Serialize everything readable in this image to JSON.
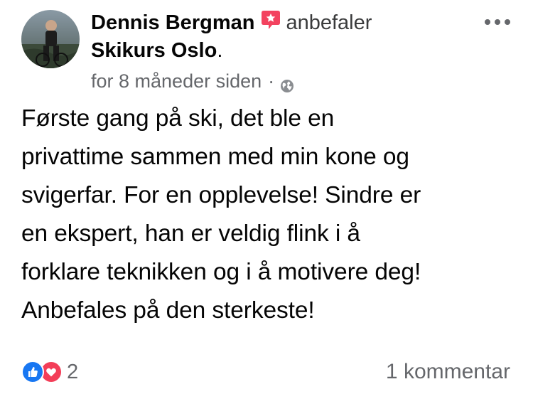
{
  "post": {
    "author": "Dennis Bergman",
    "verb": "anbefaler",
    "page_name": "Skikurs Oslo",
    "period": ".",
    "timestamp": "for 8 måneder siden",
    "separator": "·",
    "privacy_icon": "globe-icon",
    "recommend_icon": "recommend-badge-icon",
    "recommend_color": "#f3425f",
    "body": "Første gang på ski, det ble en\nprivattime sammen med min kone og\nsvigerfar. For en opplevelse! Sindre er\nen ekspert, han er veldig flink i å\nforklare teknikken og i å motivere deg!\nAnbefales på den sterkeste!"
  },
  "footer": {
    "reaction_icons": [
      "like-icon",
      "love-icon"
    ],
    "like_color": "#1877f2",
    "love_color": "#f33e58",
    "reaction_count": "2",
    "comments_label": "1 kommentar"
  }
}
